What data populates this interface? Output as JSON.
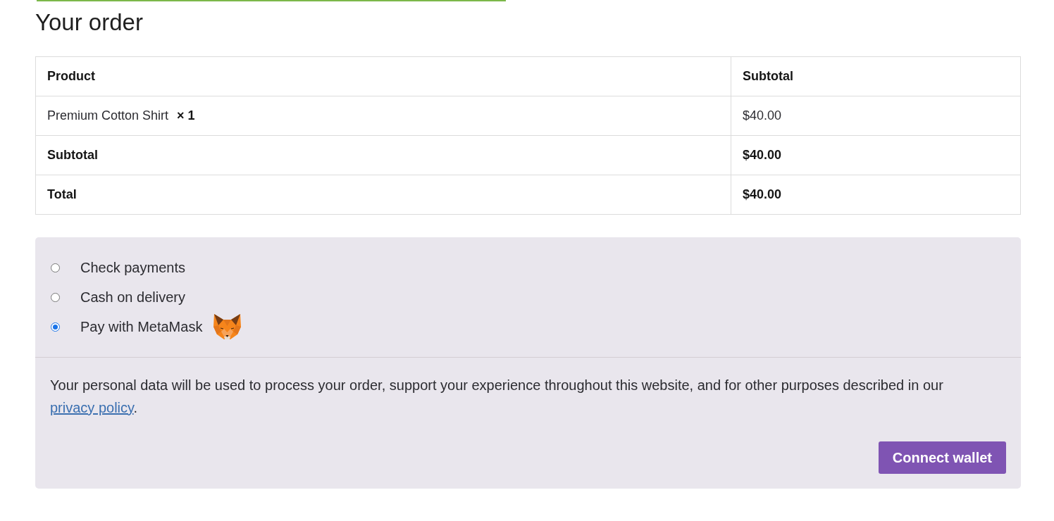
{
  "heading": "Your order",
  "order_table": {
    "columns": [
      "Product",
      "Subtotal"
    ],
    "items": [
      {
        "product": "Premium Cotton Shirt",
        "quantity": "× 1",
        "subtotal": "$40.00"
      }
    ],
    "totals": [
      {
        "label": "Subtotal",
        "value": "$40.00"
      },
      {
        "label": "Total",
        "value": "$40.00"
      }
    ]
  },
  "payment_methods": [
    {
      "label": "Check payments",
      "selected": false,
      "kind": "plain"
    },
    {
      "label": "Cash on delivery",
      "selected": false,
      "kind": "plain"
    },
    {
      "label": "Pay with MetaMask",
      "selected": true,
      "kind": "logo"
    }
  ],
  "privacy_notice": {
    "text": "Your personal data will be used to process your order, support your experience throughout this website, and for other purposes described in our",
    "link": "privacy policy",
    "after_link": "."
  },
  "button": "Connect wallet"
}
